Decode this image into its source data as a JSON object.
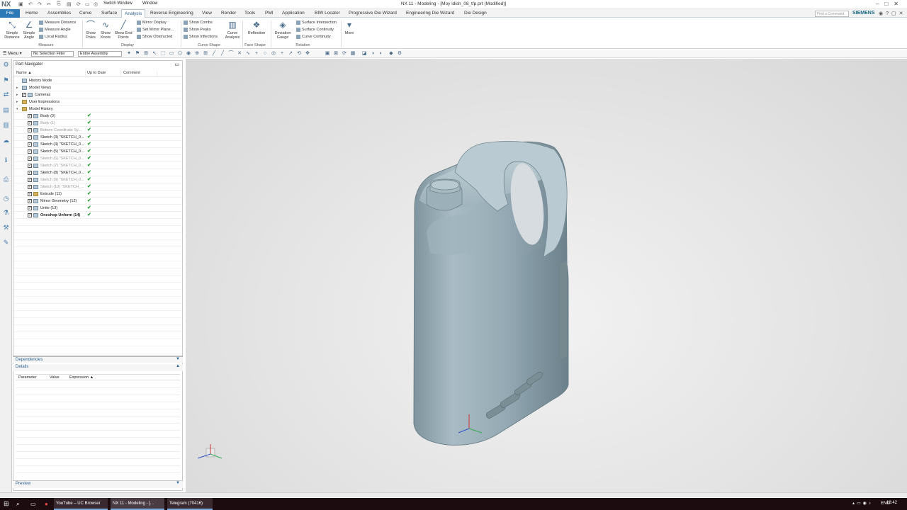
{
  "app": {
    "logo": "NX",
    "window_title": "NX 11 - Modeling - [Moy idish_08_tfp.prt (Modified)]",
    "switch_window": "Switch Window",
    "window_menu": "Window",
    "brand": "SIEMENS",
    "search_placeholder": "Find a Command"
  },
  "menu": {
    "file": "File",
    "tabs": [
      "Home",
      "Assemblies",
      "Curve",
      "Surface",
      "Analysis",
      "Reverse Engineering",
      "View",
      "Render",
      "Tools",
      "PMI",
      "Application",
      "BIW Locator",
      "Progressive Die Wizard",
      "Engineering Die Wizard",
      "Die Design"
    ],
    "active_tab": "Analysis"
  },
  "ribbon": {
    "measure": {
      "simple_distance": "Simple Distance",
      "simple_angle": "Simple Angle",
      "measure_distance": "Measure Distance",
      "measure_angle": "Measure Angle",
      "local_radius": "Local Radius",
      "group": "Measure"
    },
    "display": {
      "show_poles": "Show Poles",
      "show_knots": "Show Knots",
      "show_end_points": "Show End Points",
      "mirror_display": "Mirror Display",
      "set_mirror_plane": "Set Mirror Plane...",
      "show_obstructed": "Show Obstructed",
      "group": "Display"
    },
    "curve_shape": {
      "show_combs": "Show Combs",
      "show_peaks": "Show Peaks",
      "show_inflections": "Show Inflections",
      "curve_analysis": "Curve Analysis",
      "group": "Curve Shape"
    },
    "face_shape": {
      "reflection": "Reflection",
      "group": "Face Shape"
    },
    "relation": {
      "deviation_gauge": "Deviation Gauge",
      "surface_intersection": "Surface Intersection",
      "surface_continuity": "Surface Continuity",
      "curve_continuity": "Curve Continuity",
      "group": "Relation"
    },
    "more": "More"
  },
  "selection_bar": {
    "menu": "Menu",
    "filter": "No Selection Filter",
    "scope": "Entire Assembly"
  },
  "navigator": {
    "title": "Part Navigator",
    "columns": {
      "name": "Name",
      "up_to_date": "Up to Date",
      "comment": "Comment"
    },
    "rows": [
      {
        "label": "History Mode",
        "indent": 0,
        "exp": "",
        "icon": "clock",
        "cb": false,
        "chk": false,
        "gray": false,
        "bold": false
      },
      {
        "label": "Model Views",
        "indent": 0,
        "exp": "+",
        "icon": "gear",
        "cb": false,
        "chk": false,
        "gray": false,
        "bold": false
      },
      {
        "label": "Cameras",
        "indent": 0,
        "exp": "+",
        "icon": "gear",
        "cb": true,
        "chk": false,
        "gray": false,
        "bold": false
      },
      {
        "label": "User Expressions",
        "indent": 0,
        "exp": "+",
        "icon": "folder",
        "cb": false,
        "chk": false,
        "gray": false,
        "bold": false
      },
      {
        "label": "Model History",
        "indent": 0,
        "exp": "-",
        "icon": "folder",
        "cb": false,
        "chk": false,
        "gray": false,
        "bold": false
      },
      {
        "label": "Body (0)",
        "indent": 1,
        "exp": "",
        "icon": "gear",
        "cb": true,
        "chk": true,
        "gray": false,
        "bold": false
      },
      {
        "label": "Body (1)",
        "indent": 1,
        "exp": "",
        "icon": "gear",
        "cb": true,
        "chk": true,
        "gray": true,
        "bold": false
      },
      {
        "label": "Bottom Coordinate Sy...",
        "indent": 1,
        "exp": "",
        "icon": "gear",
        "cb": true,
        "chk": true,
        "gray": true,
        "bold": false
      },
      {
        "label": "Sketch (3) \"SKETCH_0...",
        "indent": 1,
        "exp": "",
        "icon": "gear",
        "cb": true,
        "chk": true,
        "gray": false,
        "bold": false
      },
      {
        "label": "Sketch (4) \"SKETCH_0...",
        "indent": 1,
        "exp": "",
        "icon": "gear",
        "cb": true,
        "chk": true,
        "gray": false,
        "bold": false
      },
      {
        "label": "Sketch (5) \"SKETCH_0...",
        "indent": 1,
        "exp": "",
        "icon": "gear",
        "cb": true,
        "chk": true,
        "gray": false,
        "bold": false
      },
      {
        "label": "Sketch (6) \"SKETCH_0...",
        "indent": 1,
        "exp": "",
        "icon": "gear",
        "cb": true,
        "chk": true,
        "gray": true,
        "bold": false
      },
      {
        "label": "Sketch (7) \"SKETCH_0...",
        "indent": 1,
        "exp": "",
        "icon": "gear",
        "cb": true,
        "chk": true,
        "gray": true,
        "bold": false
      },
      {
        "label": "Sketch (8) \"SKETCH_0...",
        "indent": 1,
        "exp": "",
        "icon": "gear",
        "cb": true,
        "chk": true,
        "gray": false,
        "bold": false
      },
      {
        "label": "Sketch (9) \"SKETCH_0...",
        "indent": 1,
        "exp": "",
        "icon": "gear",
        "cb": true,
        "chk": true,
        "gray": true,
        "bold": false
      },
      {
        "label": "Sketch (10) \"SKETCH_...",
        "indent": 1,
        "exp": "",
        "icon": "gear",
        "cb": true,
        "chk": true,
        "gray": true,
        "bold": false
      },
      {
        "label": "Extrude (11)",
        "indent": 1,
        "exp": "",
        "icon": "folder",
        "cb": true,
        "chk": true,
        "gray": false,
        "bold": false
      },
      {
        "label": "Mirror Geometry (12)",
        "indent": 1,
        "exp": "",
        "icon": "gear",
        "cb": true,
        "chk": true,
        "gray": false,
        "bold": false
      },
      {
        "label": "Unite (13)",
        "indent": 1,
        "exp": "",
        "icon": "gear",
        "cb": true,
        "chk": true,
        "gray": false,
        "bold": false
      },
      {
        "label": "Oneshop Unform (14)",
        "indent": 1,
        "exp": "",
        "icon": "gear",
        "cb": true,
        "chk": true,
        "gray": false,
        "bold": true
      }
    ]
  },
  "panels": {
    "dependencies": "Dependencies",
    "details": "Details",
    "details_columns": {
      "parameter": "Parameter",
      "value": "Value",
      "expression": "Expression"
    },
    "preview": "Preview"
  },
  "taskbar": {
    "items": [
      "YouTube – UC Browser",
      "NX 11 - Modeling - [...",
      "Telegram (70416)"
    ],
    "lang": "ENG",
    "time": "18:42"
  },
  "colors": {
    "accent": "#2b79b7",
    "model": "#8fa3ad",
    "check": "#2e9e3a"
  }
}
